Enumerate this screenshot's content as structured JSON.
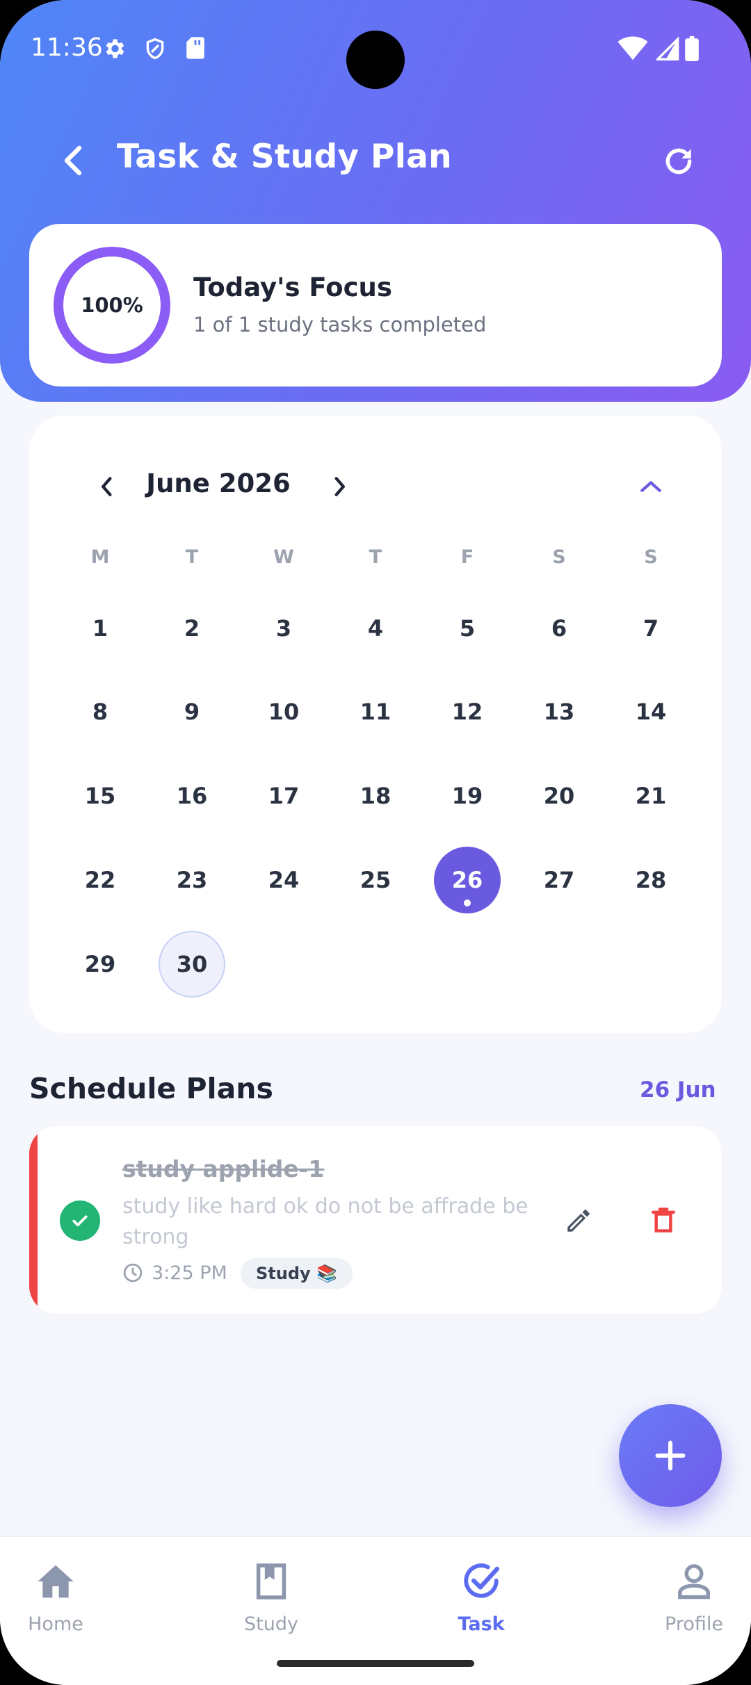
{
  "status_bar": {
    "time": "11:36",
    "left_icons": [
      "gear-icon",
      "shield-icon",
      "sd-card-icon"
    ],
    "right_icons": [
      "wifi-icon",
      "signal-icon",
      "battery-icon"
    ]
  },
  "app_bar": {
    "title": "Task & Study Plan",
    "back_icon": "chevron-left-icon",
    "refresh_icon": "refresh-icon"
  },
  "focus": {
    "progress_label": "100%",
    "progress_value": 1.0,
    "title": "Today's Focus",
    "subtitle": "1 of 1 study tasks completed"
  },
  "calendar": {
    "month_label": "June 2026",
    "weekdays": [
      "M",
      "T",
      "W",
      "T",
      "F",
      "S",
      "S"
    ],
    "first_weekday_index": 0,
    "days_in_month": 30,
    "selected_day": 26,
    "today_day": 30
  },
  "schedule": {
    "title": "Schedule Plans",
    "date_label": "26 Jun",
    "tasks": [
      {
        "title": "study applide-1",
        "description": "study like hard ok do not be affrade be strong",
        "time": "3:25 PM",
        "tag": "Study 📚",
        "completed": true,
        "accent_color": "#EF4444"
      }
    ]
  },
  "fab": {
    "icon": "plus-icon"
  },
  "bottom_nav": {
    "items": [
      {
        "label": "Home",
        "icon": "home-icon",
        "active": false
      },
      {
        "label": "Study",
        "icon": "book-icon",
        "active": false
      },
      {
        "label": "Task",
        "icon": "check-circle-icon",
        "active": true
      },
      {
        "label": "Profile",
        "icon": "person-icon",
        "active": false
      }
    ]
  },
  "colors": {
    "primary": "#6A5AE0",
    "accent_blue": "#5B6CF0",
    "success": "#22B573",
    "danger": "#EF4444",
    "header_start": "#4F86F7",
    "header_end": "#8A5BF2"
  }
}
